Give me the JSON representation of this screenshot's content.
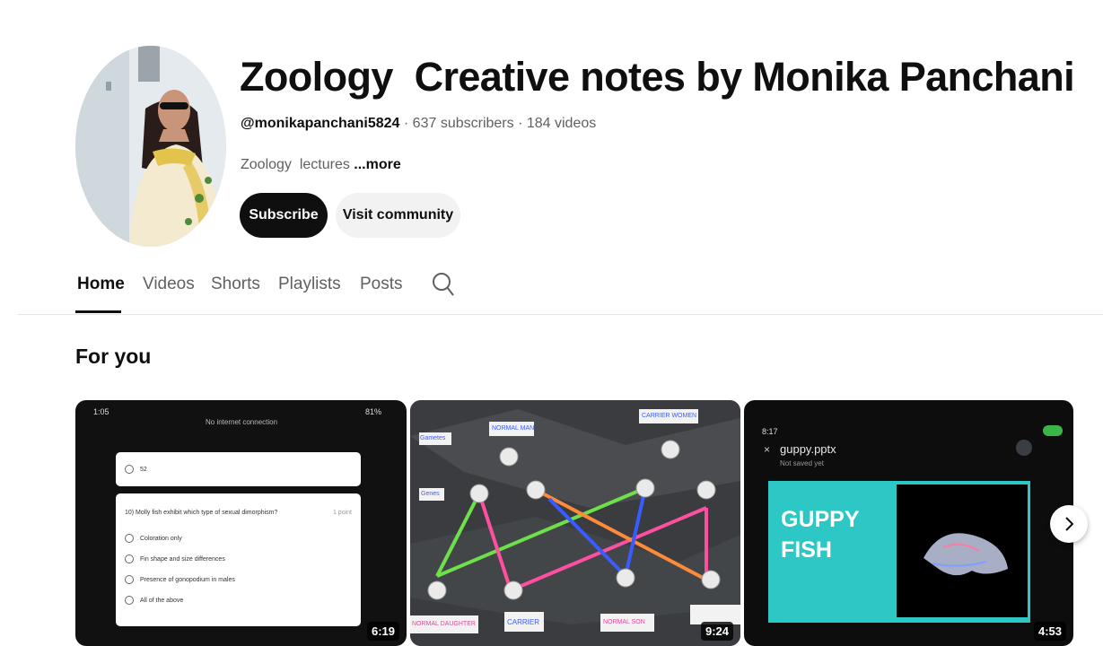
{
  "channel": {
    "title": "Zoology  Creative notes by Monika Panchani",
    "handle": "@monikapanchani5824",
    "subscribers": "637 subscribers",
    "videos_count": "184 videos",
    "separator": " · ",
    "description": "Zoology  lectures ",
    "more_label": "...more",
    "subscribe_label": "Subscribe",
    "community_label": "Visit community"
  },
  "tabs": [
    {
      "label": "Home",
      "active": true
    },
    {
      "label": "Videos"
    },
    {
      "label": "Shorts"
    },
    {
      "label": "Playlists"
    },
    {
      "label": "Posts"
    }
  ],
  "search_icon": "search-icon",
  "section_title": "For you",
  "videos": [
    {
      "duration": "6:19",
      "status_time": "1:05",
      "battery": "81%",
      "connection": "No internet connection",
      "prev_option": "52",
      "question": "10) Molly fish exhibit which type of sexual dimorphism?",
      "question_bold": "sexual dimorphism?",
      "points": "1 point",
      "options": [
        "Coloration only",
        "Fin shape and size differences",
        "Presence of gonopodium in males",
        "All of the above"
      ]
    },
    {
      "duration": "9:24",
      "labels": [
        "NORMAL MAN",
        "CARRIER WOMEN",
        "NORMAL DAUGHTER",
        "CARRIER",
        "NORMAL SON",
        "Genes",
        "Gametes"
      ]
    },
    {
      "duration": "4:53",
      "status_time": "8:17",
      "file_name": "guppy.pptx",
      "file_status": "Not saved yet",
      "slide_line1": "GUPPY",
      "slide_line2": "FISH"
    }
  ],
  "next_icon": "chevron-right-icon",
  "colors": {
    "subscribe_bg": "#0f0f0f",
    "slide_teal": "#2dc8c6",
    "text_secondary": "#606060"
  }
}
